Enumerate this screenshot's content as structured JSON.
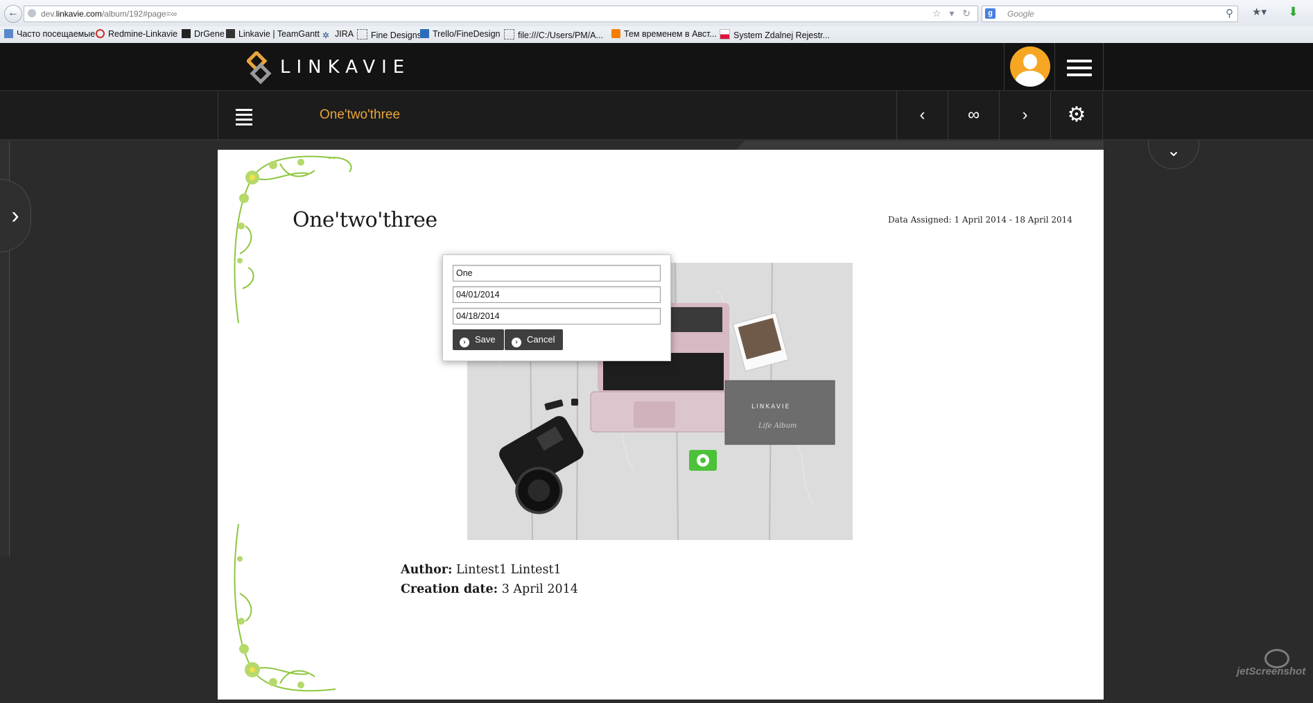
{
  "browser": {
    "url_prefix": "dev.",
    "url_domain": "linkavie.com",
    "url_path": "/album/192#page=∞",
    "search_placeholder": "Google",
    "bookmarks": [
      "Часто посещаемые",
      "Redmine-Linkavie",
      "DrGene",
      "Linkavie | TeamGantt",
      "JIRA",
      "Fine Designs",
      "Trello/FineDesign",
      "file:///C:/Users/PM/A...",
      "Тем временем в Авст...",
      "System Zdalnej Rejestr..."
    ]
  },
  "header": {
    "logo_text": "LINKAVIE"
  },
  "toolbar": {
    "album_title": "One'two'three",
    "prev_label": "‹",
    "infinity_label": "∞",
    "next_label": "›"
  },
  "page": {
    "title": "One'two'three",
    "date_assigned": "Data Assigned: 1 April 2014 - 18 April 2014",
    "author_label": "Author:",
    "author_value": "Lintest1 Lintest1",
    "creation_label": "Creation date:",
    "creation_value": "3 April 2014",
    "cover_text": "LINKAVIE",
    "cover_script": "Life Album"
  },
  "popup": {
    "title_value": "One",
    "start_date_value": "04/01/2014",
    "end_date_value": "04/18/2014",
    "save_label": "Save",
    "cancel_label": "Cancel"
  },
  "watermark": "jetScreenshot",
  "colors": {
    "accent": "#e8a53a",
    "header_bg": "#131313",
    "toolbar_bg": "#1c1c1c",
    "avatar": "#f5a623",
    "floral": "#8dc63f"
  },
  "icons": [
    "back-arrow-icon",
    "globe-icon",
    "star-icon",
    "refresh-icon",
    "google-icon",
    "search-icon",
    "bookmark-star-icon",
    "download-icon",
    "avatar-icon",
    "hamburger-icon",
    "list-icon",
    "prev-icon",
    "infinity-icon",
    "next-icon",
    "gear-icon",
    "expand-right-icon",
    "chevron-down-icon",
    "arrow-circle-icon"
  ]
}
